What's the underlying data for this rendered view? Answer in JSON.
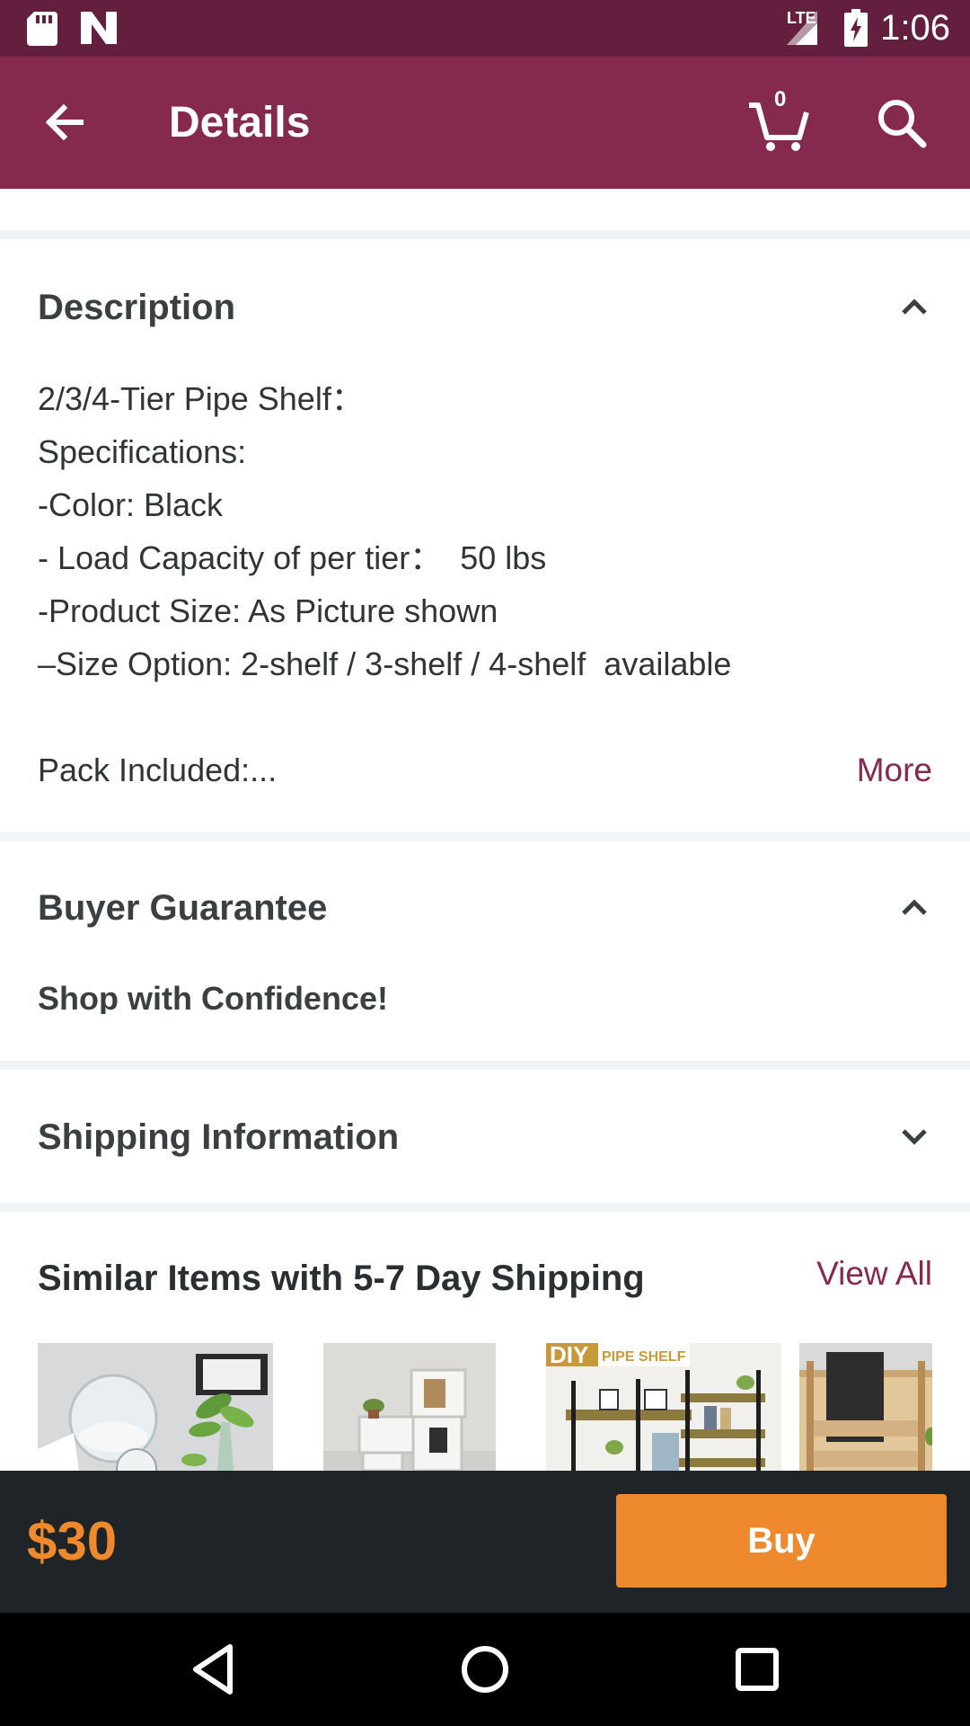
{
  "status_bar": {
    "time": "1:06",
    "network_label": "LTE",
    "icons": [
      "sd-card-icon",
      "notification-n-icon",
      "signal-icon",
      "battery-charging-icon"
    ]
  },
  "app_bar": {
    "title": "Details",
    "cart_count": "0",
    "icons": [
      "back-arrow-icon",
      "cart-icon",
      "search-icon"
    ]
  },
  "description": {
    "title": "Description",
    "lines": [
      "2/3/4-Tier Pipe Shelf：",
      "Specifications:",
      "-Color: Black",
      "- Load Capacity of per tier：  50 lbs",
      "-Product Size: As Picture shown",
      "–Size Option: 2-shelf / 3-shelf / 4-shelf  available"
    ],
    "pack_line": "Pack Included:...",
    "more_label": "More",
    "expanded": true
  },
  "buyer_guarantee": {
    "title": "Buyer Guarantee",
    "subtitle": "Shop with Confidence!",
    "expanded": true
  },
  "shipping": {
    "title": "Shipping Information",
    "expanded": false
  },
  "similar": {
    "title": "Similar Items with 5-7 Day Shipping",
    "view_all_label": "View All",
    "items": [
      {
        "name": "hanging glass planter"
      },
      {
        "name": "white cube wall shelf"
      },
      {
        "name": "DIY pipe shelf",
        "caption": "DIY PIPE SHELF"
      },
      {
        "name": "wooden wall organizer"
      }
    ]
  },
  "bottom_bar": {
    "price": "$30",
    "buy_label": "Buy"
  },
  "colors": {
    "status_bar": "#631f3d",
    "app_bar": "#85294f",
    "accent_link": "#85294f",
    "price": "#ee8a2d",
    "buy_button": "#ee8a2d",
    "bottom_bar": "#1e2427"
  }
}
